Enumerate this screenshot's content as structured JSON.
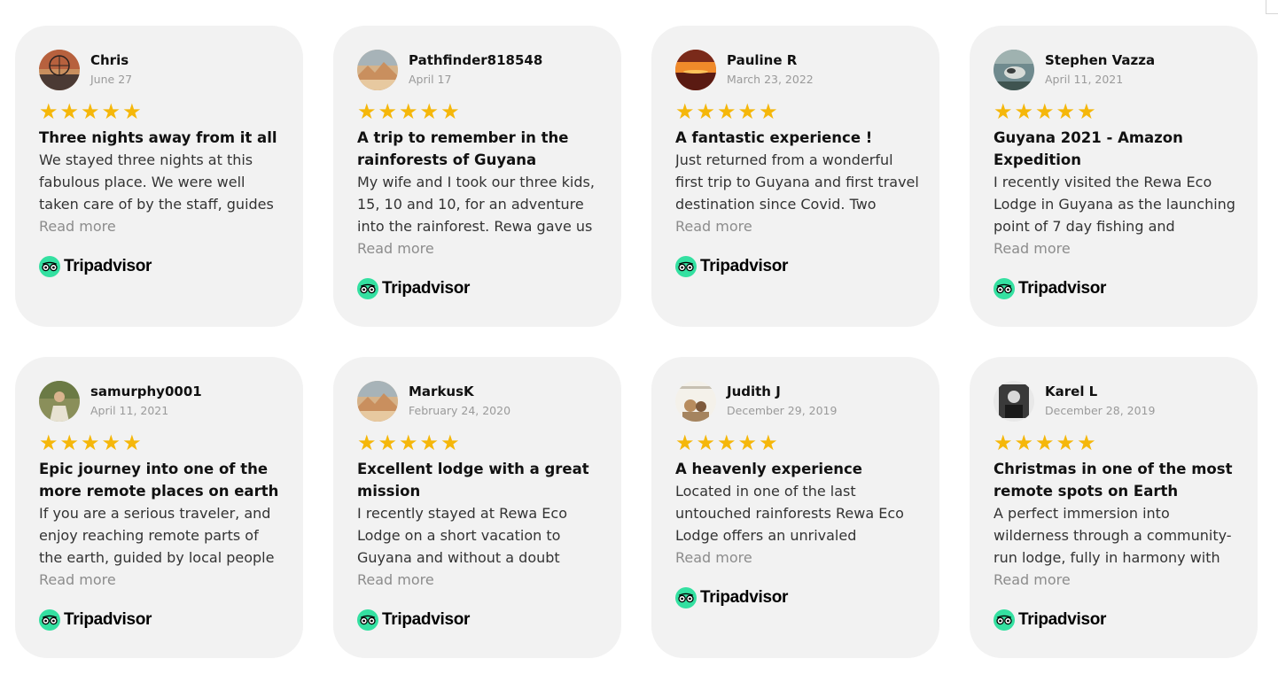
{
  "brand": {
    "name": "Tripadvisor",
    "color": "#34e0a1"
  },
  "star_color": "#f5b70a",
  "reviews": [
    {
      "author": "Chris",
      "date": "June 27",
      "rating": 5,
      "title": "Three nights away from it all",
      "text": "We stayed three nights at this fabulous place. We were well taken care of by the staff, guides",
      "read_more": "Read more"
    },
    {
      "author": "Pathfinder818548",
      "date": "April 17",
      "rating": 5,
      "title": "A trip to remember in the rainforests of Guyana",
      "text": "My wife and I took our three kids, 15, 10 and 10, for an adventure into the rainforest. Rewa gave us",
      "read_more": "Read more"
    },
    {
      "author": "Pauline R",
      "date": "March 23, 2022",
      "rating": 5,
      "title": "A fantastic experience !",
      "text": "Just returned from a wonderful first trip to Guyana and first travel destination since Covid. Two",
      "read_more": "Read more"
    },
    {
      "author": "Stephen Vazza",
      "date": "April 11, 2021",
      "rating": 5,
      "title": "Guyana 2021 - Amazon Expedition",
      "text": "I recently visited the Rewa Eco Lodge in Guyana as the launching point of 7 day fishing and",
      "read_more": "Read more"
    },
    {
      "author": "samurphy0001",
      "date": "April 11, 2021",
      "rating": 5,
      "title": "Epic journey into one of the more remote places on earth",
      "text": "If you are a serious traveler, and enjoy reaching remote parts of the earth, guided by local people",
      "read_more": "Read more"
    },
    {
      "author": "MarkusK",
      "date": "February 24, 2020",
      "rating": 5,
      "title": "Excellent lodge with a great mission",
      "text": "I recently stayed at Rewa Eco Lodge on a short vacation to Guyana and without a doubt",
      "read_more": "Read more"
    },
    {
      "author": "Judith J",
      "date": "December 29, 2019",
      "rating": 5,
      "title": "A heavenly experience",
      "text": "Located in one of the last untouched rainforests Rewa Eco Lodge offers an unrivaled",
      "read_more": "Read more"
    },
    {
      "author": "Karel L",
      "date": "December 28, 2019",
      "rating": 5,
      "title": "Christmas in one of the most remote spots on Earth",
      "text": "A perfect immersion into wilderness through a community-run lodge, fully in harmony with",
      "read_more": "Read more"
    }
  ]
}
